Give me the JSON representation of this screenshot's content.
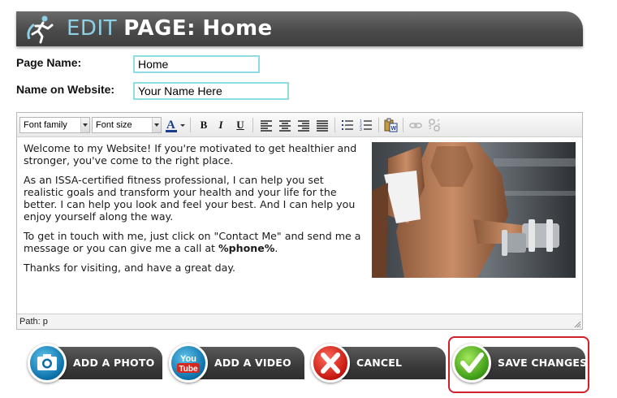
{
  "header": {
    "title_part1": "EDIT",
    "title_part2": "PAGE:",
    "page": "Home",
    "logo_icon": "running-man-icon"
  },
  "form": {
    "page_name_label": "Page Name:",
    "page_name_value": "Home",
    "website_name_label": "Name on Website:",
    "website_name_value": "Your Name Here"
  },
  "toolbar": {
    "font_family": "Font family",
    "font_size": "Font size",
    "bold": "B",
    "italic": "I",
    "underline": "U"
  },
  "content": {
    "p1": "Welcome to my Website! If you're motivated to get healthier and stronger, you've come to the right place.",
    "p2": "As an ISSA-certified fitness professional, I can help you set realistic goals and transform your health and your life for the better. I can help you look and feel your best. And I can help you enjoy yourself along the way.",
    "p3_a": "To get in touch with me, just click on \"Contact Me\" and send me a message or you can give me a call at ",
    "p3_b": "%phone%",
    "p3_c": ".",
    "p4": "Thanks for visiting, and have a great day."
  },
  "statusbar": {
    "path": "Path: p"
  },
  "buttons": {
    "photo": "ADD A PHOTO",
    "video": "ADD A VIDEO",
    "cancel": "CANCEL",
    "save": "SAVE CHANGES",
    "youtube_you": "You",
    "youtube_tube": "Tube"
  },
  "colors": {
    "accent": "#8fd0e6",
    "field_border": "#8fdbe3",
    "save_highlight": "#d0202a"
  }
}
